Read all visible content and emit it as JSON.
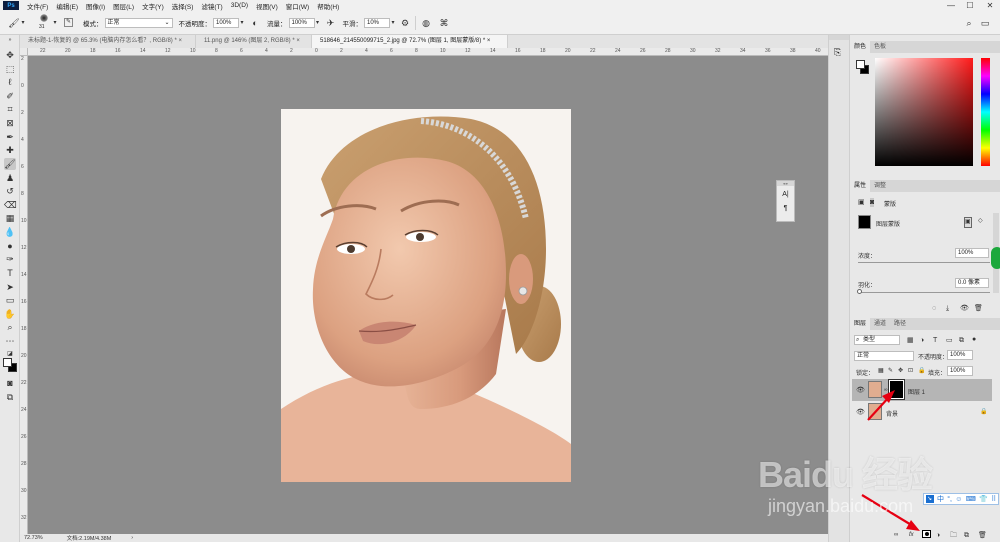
{
  "app": {
    "logo": "Ps"
  },
  "menu": [
    "文件(F)",
    "编辑(E)",
    "图像(I)",
    "图层(L)",
    "文字(Y)",
    "选择(S)",
    "滤镜(T)",
    "3D(D)",
    "视图(V)",
    "窗口(W)",
    "帮助(H)"
  ],
  "window_controls": {
    "minimize": "—",
    "maximize": "☐",
    "close": "✕"
  },
  "options": {
    "brush_size": "31",
    "mode_label": "模式：",
    "mode_value": "正常",
    "opacity_label": "不透明度：",
    "opacity_value": "100%",
    "flow_label": "流量：",
    "flow_value": "100%",
    "smooth_label": "平滑：",
    "smooth_value": "10%"
  },
  "tabs": [
    {
      "label": "未标题-1-恢复的 @ 65.3% (电脑内存怎么看？, RGB/8) *",
      "close": "×"
    },
    {
      "label": "11.png @ 146% (图层 2, RGB/8) *",
      "close": "×"
    },
    {
      "label": "518646_214550099715_2.jpg @ 72.7% (图层 1, 图层蒙版/8) *",
      "close": "×"
    }
  ],
  "rulers": {
    "h": [
      "22",
      "20",
      "18",
      "16",
      "14",
      "12",
      "10",
      "8",
      "6",
      "4",
      "2",
      "0",
      "2",
      "4",
      "6",
      "8",
      "10",
      "12",
      "14",
      "16",
      "18",
      "20",
      "22",
      "24",
      "26",
      "28",
      "30",
      "32",
      "34",
      "36",
      "38",
      "40",
      "42"
    ],
    "v": [
      "2",
      "0",
      "2",
      "4",
      "6",
      "8",
      "10",
      "12",
      "14",
      "16",
      "18",
      "20",
      "22",
      "24",
      "26",
      "28",
      "30",
      "32"
    ]
  },
  "status": {
    "zoom": "72.73%",
    "doc": "文档:2.19M/4.38M",
    "arrow": "›"
  },
  "color_panel": {
    "tabs": [
      "颜色",
      "色板"
    ]
  },
  "properties_panel": {
    "tabs": [
      "属性",
      "调整"
    ],
    "mask_title": "蒙版",
    "mask_name": "图层蒙版",
    "density_label": "浓度：",
    "density_value": "100%",
    "feather_label": "羽化：",
    "feather_value": "0.0 像素"
  },
  "layers_panel": {
    "tabs": [
      "图层",
      "通道",
      "路径"
    ],
    "filter_value": "类型",
    "blend_value": "正常",
    "opacity_label": "不透明度：",
    "opacity_value": "100%",
    "lock_label": "锁定：",
    "fill_label": "填充：",
    "fill_value": "100%",
    "layers": [
      {
        "name": "图层 1",
        "selected": true
      },
      {
        "name": "背景",
        "selected": false
      }
    ]
  },
  "mini_panel": {
    "a": "A|",
    "b": "¶"
  },
  "watermark": {
    "text": "Baidu 经验",
    "url": "jingyan.baidu.com"
  },
  "ime_bar": {
    "items": [
      "中",
      "°,",
      "☺",
      "⌨",
      "👕",
      "⠿"
    ]
  },
  "colors": {
    "accent": "#e60012",
    "panel": "#e8e8e8",
    "canvas": "#8c8c8c"
  }
}
